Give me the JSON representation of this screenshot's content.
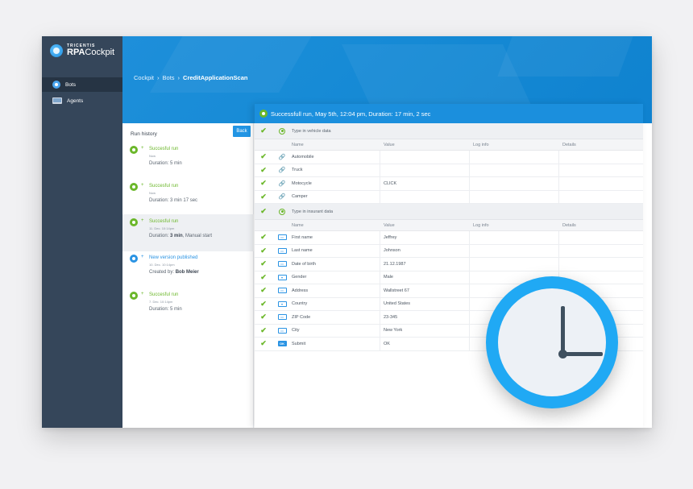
{
  "app": {
    "logo_brand": "TRICENTIS",
    "logo_product_a": "RPA",
    "logo_product_b": "Cockpit"
  },
  "sidebar": {
    "items": [
      {
        "label": "Bots",
        "icon": "bot-icon",
        "active": true
      },
      {
        "label": "Agents",
        "icon": "monitor-icon",
        "active": false
      }
    ]
  },
  "breadcrumb": {
    "items": [
      "Cockpit",
      "Bots"
    ],
    "current": "CreditApplicationScan",
    "separator": "›"
  },
  "history": {
    "title": "Run history",
    "back_label": "Back",
    "runs": [
      {
        "title": "Succesful run",
        "time": "Now",
        "detail": "Duration: 5 min",
        "detail_bold": "",
        "detail_suffix": "",
        "type": "success"
      },
      {
        "title": "Succesful run",
        "time": "Now",
        "detail": "Duration: 3 min 17 sec",
        "detail_bold": "",
        "detail_suffix": "",
        "type": "success"
      },
      {
        "title": "Succesful run",
        "time": "11. Dec. 10:14pm",
        "detail": "Duration: ",
        "detail_bold": "3 min",
        "detail_suffix": ", Manual start",
        "type": "success",
        "selected": true
      },
      {
        "title": "New version published",
        "time": "10. Dec. 10:14pm",
        "detail": "Created by: ",
        "detail_bold": "Bob Meier",
        "detail_suffix": "",
        "type": "publish"
      },
      {
        "title": "Succesful run",
        "time": "7. Dec. 10:14pm",
        "detail": "Duration: 5 min",
        "detail_bold": "",
        "detail_suffix": "",
        "type": "success"
      }
    ]
  },
  "run_banner": "Successfull run, May 5th, 12:04 pm, Duration: 17 min, 2 sec",
  "columns": {
    "name": "Name",
    "value": "Value",
    "log": "Log info",
    "details": "Details"
  },
  "groups": [
    {
      "label": "Type in vehicle data",
      "rows": [
        {
          "name": "Automobile",
          "value": "",
          "icon": "link-icon"
        },
        {
          "name": "Truck",
          "value": "",
          "icon": "link-icon"
        },
        {
          "name": "Motocycle",
          "value": "CLICK",
          "icon": "link-icon"
        },
        {
          "name": "Camper",
          "value": "",
          "icon": "link-icon"
        }
      ]
    },
    {
      "label": "Type in insurant data",
      "rows": [
        {
          "name": "First name",
          "value": "Jeffrey",
          "icon": "textfield-icon"
        },
        {
          "name": "Last name",
          "value": "Johnson",
          "icon": "textfield-icon"
        },
        {
          "name": "Date of birth",
          "value": "21.12.1987",
          "icon": "textfield-icon"
        },
        {
          "name": "Gender",
          "value": "Male",
          "icon": "dropdown-icon"
        },
        {
          "name": "Address",
          "value": "Wallstreet 67",
          "icon": "textfield-icon"
        },
        {
          "name": "Country",
          "value": "United States",
          "icon": "dropdown-icon"
        },
        {
          "name": "ZIP Code",
          "value": "23-345",
          "icon": "textfield-icon"
        },
        {
          "name": "City",
          "value": "New York",
          "icon": "textfield-icon"
        },
        {
          "name": "Submit",
          "value": "OK",
          "icon": "ok-button-icon"
        }
      ]
    }
  ],
  "icons": {
    "check": "✔",
    "link": "🔗",
    "textfield": "▭",
    "dropdown": "▾",
    "ok": "OK"
  },
  "colors": {
    "accent": "#1b8fdd",
    "sidebar": "#35465a",
    "success": "#6bb72a",
    "clock_ring": "#20a9f4"
  }
}
